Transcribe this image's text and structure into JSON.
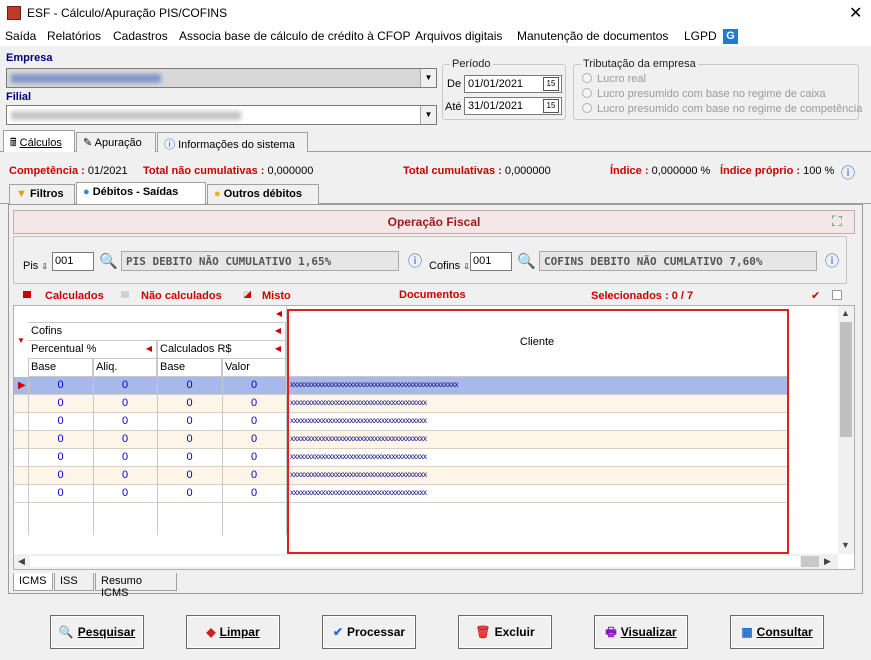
{
  "window": {
    "title": "ESF - Cálculo/Apuração PIS/COFINS",
    "close": "✕"
  },
  "menu": [
    "Saída",
    "Relatórios",
    "Cadastros",
    "Associa base de cálculo de crédito à CFOP",
    "Arquivos digitais",
    "Manutenção de documentos",
    "LGPD"
  ],
  "lgpd_icon": "G",
  "empresa": {
    "label": "Empresa"
  },
  "filial": {
    "label": "Filial"
  },
  "periodo": {
    "legend": "Período",
    "de_label": "De",
    "de_value": "01/01/2021",
    "ate_label": "Até",
    "ate_value": "31/01/2021",
    "cal_icon": "15"
  },
  "tributacao": {
    "legend": "Tributação da empresa",
    "options": [
      "Lucro real",
      "Lucro presumido com base no regime de caixa",
      "Lucro presumido com base no regime de competência"
    ]
  },
  "tabs": [
    "Cálculos",
    "Apuração",
    "Informações do sistema"
  ],
  "info": {
    "competencia_label": "Competência :",
    "competencia_value": "01/2021",
    "tnc_label": "Total não cumulativas :",
    "tnc_value": "0,000000",
    "tc_label": "Total cumulativas :",
    "tc_value": "0,000000",
    "indice_label": "Índice :",
    "indice_value": "0,000000 %",
    "indice_proprio_label": "Índice próprio :",
    "indice_proprio_value": "100 %"
  },
  "subtabs": [
    "Filtros",
    "Débitos - Saídas",
    "Outros débitos"
  ],
  "operacao": {
    "title": "Operação Fiscal"
  },
  "pis": {
    "label": "Pis",
    "code": "001",
    "desc": "PIS DEBITO NÃO CUMULATIVO 1,65%"
  },
  "cofins": {
    "label": "Cofins",
    "code": "001",
    "desc": "COFINS DEBITO NÃO CUMLATIVO 7,60%"
  },
  "legend_row": {
    "calculados": "Calculados",
    "nao_calculados": "Não calculados",
    "misto": "Misto",
    "documentos": "Documentos",
    "selecionados": "Selecionados : 0 / 7"
  },
  "grid": {
    "group_cofins": "Cofins",
    "percentual": "Percentual %",
    "calculados": "Calculados R$",
    "cols": [
      "Base",
      "Aliq.",
      "Base",
      "Valor"
    ],
    "cliente": "Cliente",
    "rows": [
      {
        "values": [
          "0",
          "0",
          "0",
          "0"
        ],
        "cliente": "xxxxxxxxxxxxxxxxxxxxxxxxxxxxxxxxxxxxxxxxxxxxxxxx"
      },
      {
        "values": [
          "0",
          "0",
          "0",
          "0"
        ],
        "cliente": "xxxxxxxxxxxxxxxxxxxxxxxxxxxxxxxxxxxxxxx"
      },
      {
        "values": [
          "0",
          "0",
          "0",
          "0"
        ],
        "cliente": "xxxxxxxxxxxxxxxxxxxxxxxxxxxxxxxxxxxxxxx"
      },
      {
        "values": [
          "0",
          "0",
          "0",
          "0"
        ],
        "cliente": "xxxxxxxxxxxxxxxxxxxxxxxxxxxxxxxxxxxxxxx"
      },
      {
        "values": [
          "0",
          "0",
          "0",
          "0"
        ],
        "cliente": "xxxxxxxxxxxxxxxxxxxxxxxxxxxxxxxxxxxxxxx"
      },
      {
        "values": [
          "0",
          "0",
          "0",
          "0"
        ],
        "cliente": "xxxxxxxxxxxxxxxxxxxxxxxxxxxxxxxxxxxxxxx"
      },
      {
        "values": [
          "0",
          "0",
          "0",
          "0"
        ],
        "cliente": "xxxxxxxxxxxxxxxxxxxxxxxxxxxxxxxxxxxxxxx"
      }
    ]
  },
  "bottom_tabs": [
    "ICMS",
    "ISS",
    "Resumo ICMS"
  ],
  "buttons": {
    "pesquisar": "Pesquisar",
    "limpar": "Limpar",
    "processar": "Processar",
    "excluir": "Excluir",
    "visualizar": "Visualizar",
    "consultar": "Consultar"
  },
  "colors": {
    "accent_red": "#cc0000",
    "selected_row": "#a8b8e8",
    "alt_row": "#fdf6e8",
    "highlight_border": "#dd2222"
  }
}
